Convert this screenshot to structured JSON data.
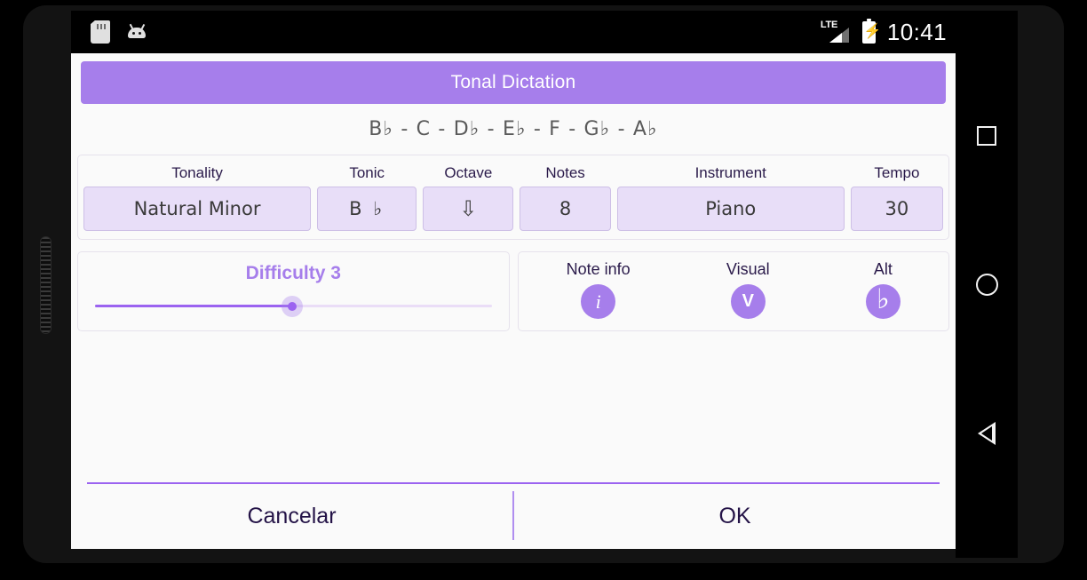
{
  "status_bar": {
    "icons_left": [
      "sdcard-icon",
      "android-icon"
    ],
    "network": "LTE",
    "battery": "charging",
    "time": "10:41"
  },
  "navbar": {
    "recents": "recents-square-icon",
    "home": "home-circle-icon",
    "back": "back-triangle-icon"
  },
  "dialog": {
    "title": "Tonal Dictation",
    "scale": "B♭ - C - D♭ - E♭ - F - G♭ - A♭",
    "params": [
      {
        "label": "Tonality",
        "value": "Natural Minor"
      },
      {
        "label": "Tonic",
        "value": "B ♭"
      },
      {
        "label": "Octave",
        "value": "⇩"
      },
      {
        "label": "Notes",
        "value": "8"
      },
      {
        "label": "Instrument",
        "value": "Piano"
      },
      {
        "label": "Tempo",
        "value": "30"
      }
    ],
    "difficulty": {
      "label": "Difficulty 3",
      "value": 3,
      "min": 1,
      "max": 6,
      "percent": 50
    },
    "actions": [
      {
        "label": "Note info",
        "glyph": "i",
        "icon": "info-icon"
      },
      {
        "label": "Visual",
        "glyph": "V",
        "icon": "visual-icon"
      },
      {
        "label": "Alt",
        "glyph": "♭",
        "icon": "flat-icon"
      }
    ],
    "footer": {
      "cancel": "Cancelar",
      "ok": "OK"
    }
  },
  "colors": {
    "accent": "#A67EEB",
    "accent_strong": "#9B63F0",
    "field_bg": "#E8DEF8",
    "dialog_bg": "#FAFAFA",
    "text_dark": "#241347"
  }
}
